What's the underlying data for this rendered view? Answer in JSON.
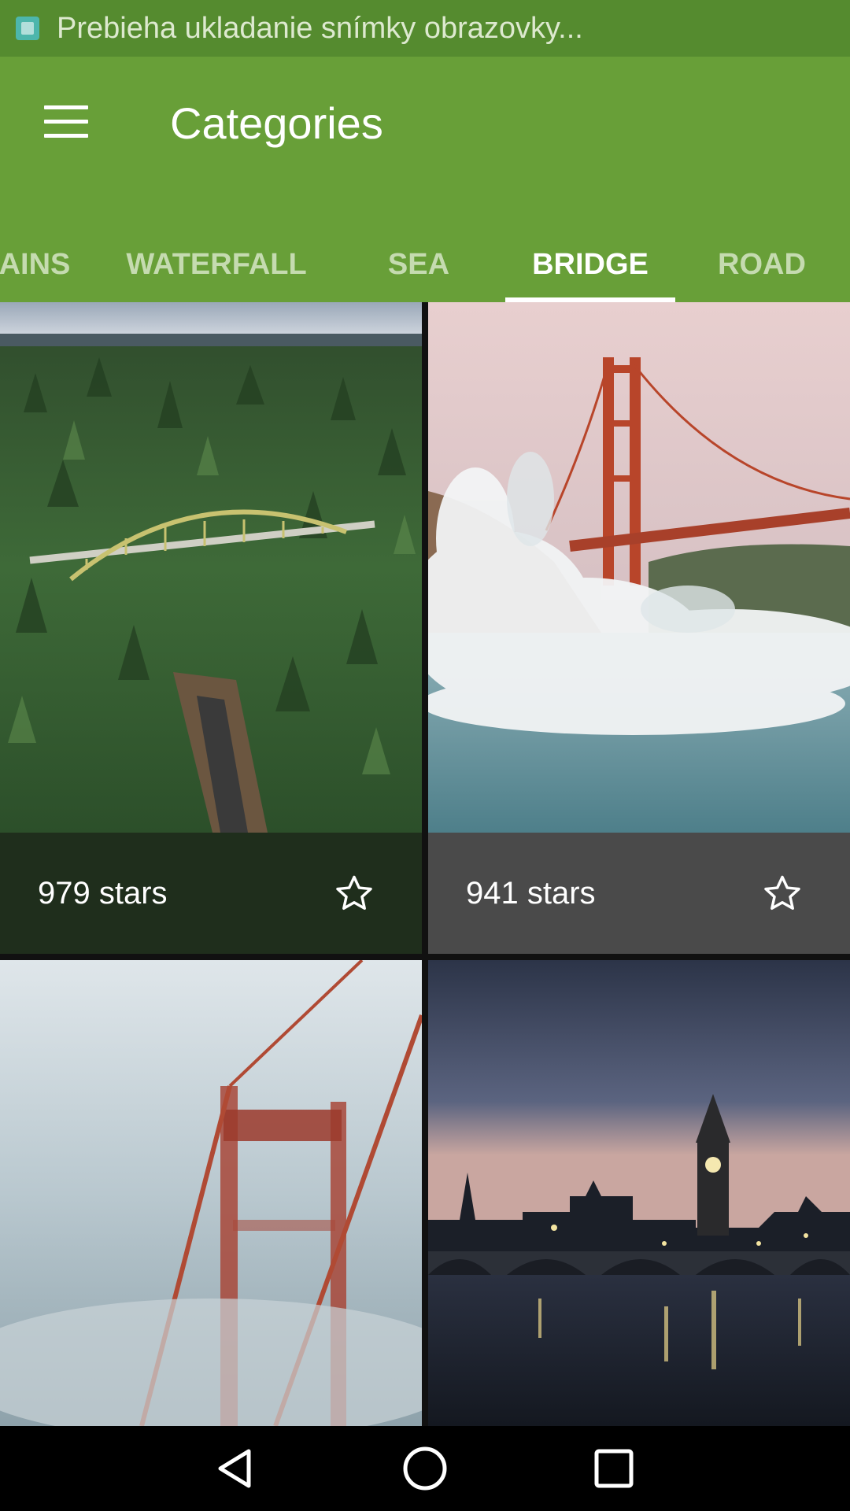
{
  "status_bar": {
    "notification_text": "Prebieha ukladanie snímky obrazovky...",
    "icon": "screenshot-icon"
  },
  "app_bar": {
    "title": "Categories",
    "menu_icon": "hamburger-menu-icon",
    "background_color": "#689f38"
  },
  "tabs": [
    {
      "label": "AINS",
      "active": false
    },
    {
      "label": "WATERFALL",
      "active": false
    },
    {
      "label": "SEA",
      "active": false
    },
    {
      "label": "BRIDGE",
      "active": true
    },
    {
      "label": "ROAD",
      "active": false
    }
  ],
  "grid": {
    "cards": [
      {
        "stars_label": "979 stars",
        "icon": "star-outline-icon",
        "image": "steel arch bridge over forested gorge",
        "footer_color": "#1f2e1c"
      },
      {
        "stars_label": "941 stars",
        "icon": "star-outline-icon",
        "image": "golden gate bridge with crashing waves",
        "footer_color": "#4a4a4a"
      },
      {
        "image": "golden gate bridge tower in fog"
      },
      {
        "image": "westminster bridge and big ben at dusk"
      }
    ]
  },
  "nav_bar": {
    "back_icon": "back-triangle-icon",
    "home_icon": "home-circle-icon",
    "recents_icon": "recents-square-icon"
  }
}
